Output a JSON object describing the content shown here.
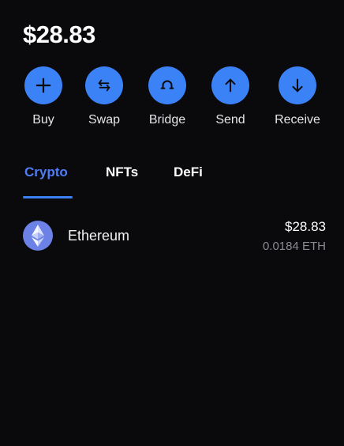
{
  "wallet": {
    "balance": "$28.83"
  },
  "actions": [
    {
      "label": "Buy",
      "icon": "plus-icon"
    },
    {
      "label": "Swap",
      "icon": "swap-arrows-icon"
    },
    {
      "label": "Bridge",
      "icon": "bridge-icon"
    },
    {
      "label": "Send",
      "icon": "arrow-up-icon"
    },
    {
      "label": "Receive",
      "icon": "arrow-down-icon"
    }
  ],
  "tabs": [
    {
      "label": "Crypto",
      "active": true
    },
    {
      "label": "NFTs",
      "active": false
    },
    {
      "label": "DeFi",
      "active": false
    }
  ],
  "assets": [
    {
      "name": "Ethereum",
      "value": "$28.83",
      "amount": "0.0184 ETH",
      "icon": "ethereum-icon"
    }
  ],
  "colors": {
    "background": "#0a0a0d",
    "accent": "#3b82f6",
    "active_tab": "#4f7df5",
    "ethereum_logo": "#6c82e6",
    "muted_text": "#8a8a94"
  }
}
